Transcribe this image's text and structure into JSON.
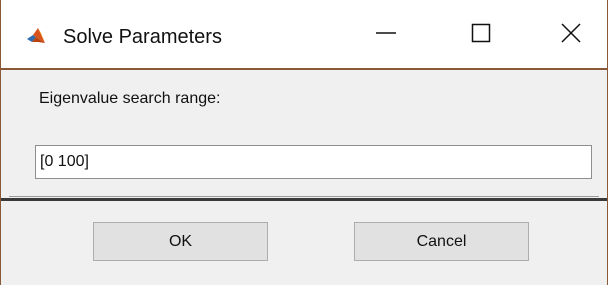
{
  "window": {
    "title": "Solve Parameters",
    "app_icon": "matlab-logo-icon",
    "controls": {
      "minimize_icon": "minimize-icon",
      "maximize_icon": "maximize-icon",
      "close_icon": "close-icon"
    }
  },
  "form": {
    "label": "Eigenvalue search range:",
    "value": "[0 100]"
  },
  "buttons": {
    "ok_label": "OK",
    "cancel_label": "Cancel"
  },
  "colors": {
    "border_accent": "#8a5a36",
    "dialog_background": "#f0f0f0",
    "button_face": "#e1e1e1"
  }
}
